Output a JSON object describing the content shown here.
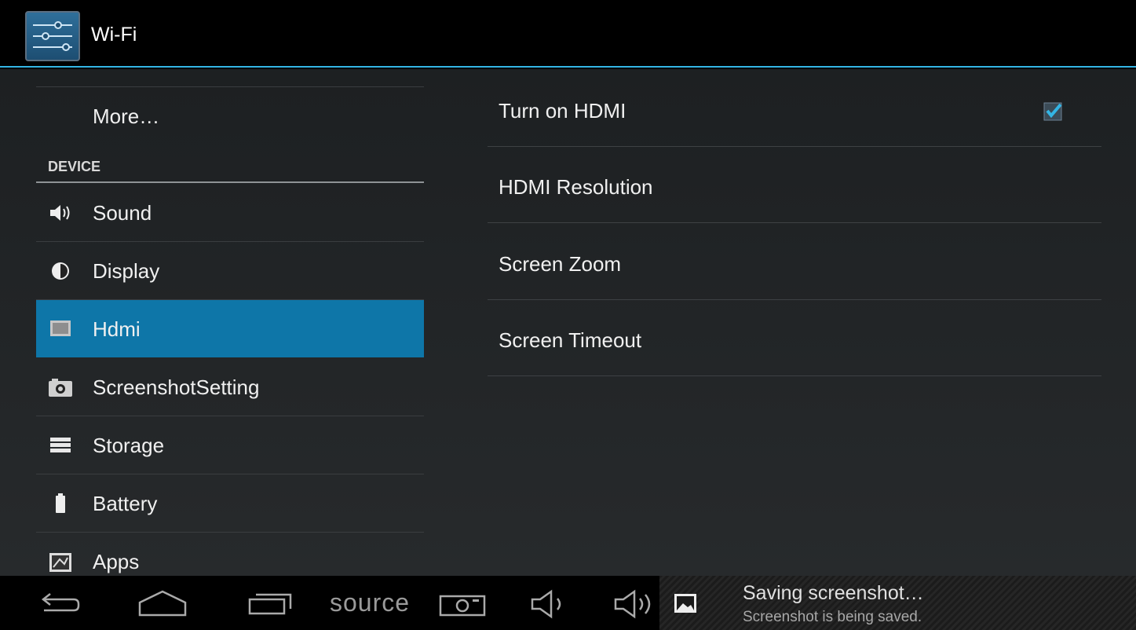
{
  "actionbar": {
    "title": "Wi-Fi",
    "icon": "settings-sliders-icon",
    "accent": "#33b5e5"
  },
  "sidebar": {
    "more_label": "More…",
    "section_header": "DEVICE",
    "selected_color": "#0e76a8",
    "items": [
      {
        "label": "Sound",
        "icon": "speaker-icon"
      },
      {
        "label": "Display",
        "icon": "brightness-icon"
      },
      {
        "label": "Hdmi",
        "icon": "monitor-icon",
        "selected": true
      },
      {
        "label": "ScreenshotSetting",
        "icon": "camera-icon"
      },
      {
        "label": "Storage",
        "icon": "storage-icon"
      },
      {
        "label": "Battery",
        "icon": "battery-icon"
      },
      {
        "label": "Apps",
        "icon": "apps-icon"
      }
    ]
  },
  "hdmi": {
    "prefs": [
      {
        "label": "Turn on HDMI",
        "checked": true
      },
      {
        "label": "HDMI Resolution"
      },
      {
        "label": "Screen Zoom"
      },
      {
        "label": "Screen Timeout"
      }
    ]
  },
  "systembar": {
    "source_label": "source",
    "notification": {
      "title": "Saving screenshot…",
      "subtitle": "Screenshot is being saved.",
      "icon": "image-icon"
    }
  }
}
